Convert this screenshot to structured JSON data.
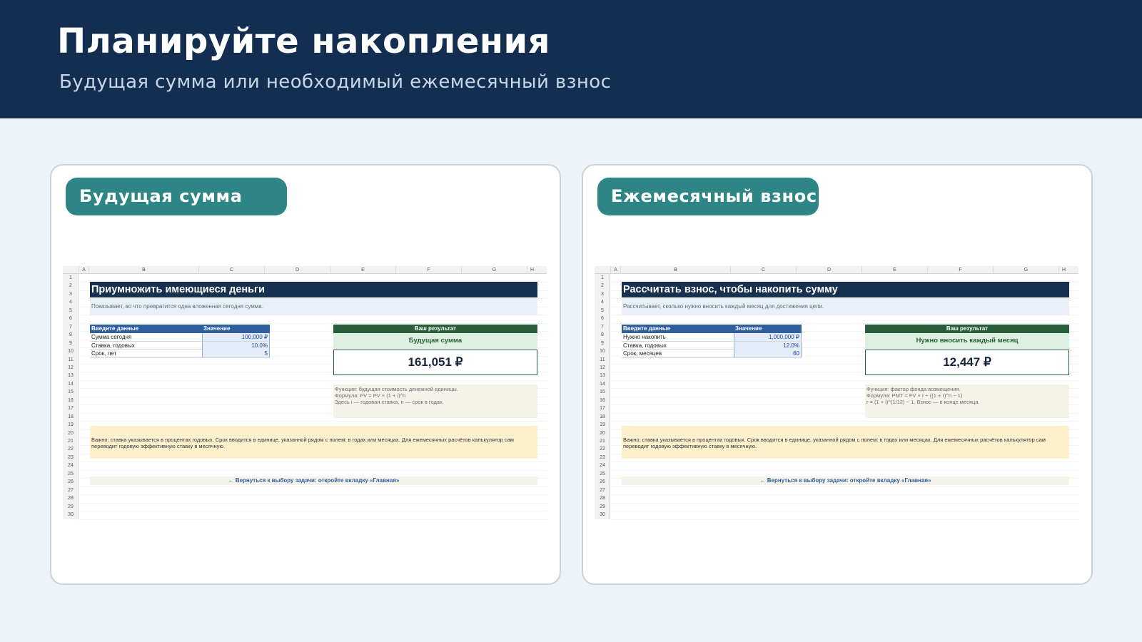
{
  "header": {
    "title": "Планируйте накопления",
    "subtitle": "Будущая сумма или необходимый ежемесячный взнос"
  },
  "columns": [
    "A",
    "B",
    "C",
    "D",
    "E",
    "F",
    "G",
    "H"
  ],
  "rows": [
    "1",
    "2",
    "3",
    "4",
    "5",
    "6",
    "7",
    "8",
    "9",
    "10",
    "11",
    "12",
    "13",
    "14",
    "15",
    "16",
    "17",
    "18",
    "19",
    "20",
    "21",
    "22",
    "23",
    "24",
    "25",
    "26",
    "27",
    "28",
    "29",
    "30"
  ],
  "left_card": {
    "pill_label": "Будущая сумма",
    "sheet": {
      "title": "Приумножить имеющиеся деньги",
      "description": "Показывает, во что превратится одна вложенная сегодня сумма.",
      "input_header": {
        "label": "Введите данные",
        "value": "Значение"
      },
      "inputs": [
        {
          "label": "Сумма сегодня",
          "value": "100,000 ₽"
        },
        {
          "label": "Ставка, годовых",
          "value": "10.0%"
        },
        {
          "label": "Срок, лет",
          "value": "5"
        }
      ],
      "result_header": "Ваш результат",
      "result_label": "Будущая сумма",
      "result_value": "161,051 ₽",
      "formula_lines": [
        "Функция: будущая стоимость денежной единицы.",
        "Формула: FV = PV × (1 + i)^n",
        "Здесь i — годовая ставка, n — срок в годах."
      ],
      "note": "Важно: ставка указывается в процентах годовых. Срок вводится в единице, указанной рядом с полем: в годах или месяцах. Для ежемесячных расчётов калькулятор сам переводит годовую эффективную ставку в месячную.",
      "back_link": "← Вернуться к выбору задачи: откройте вкладку «Главная»"
    }
  },
  "right_card": {
    "pill_label": "Ежемесячный взнос",
    "sheet": {
      "title": "Рассчитать взнос, чтобы накопить сумму",
      "description": "Рассчитывает, сколько нужно вносить каждый месяц для достижения цели.",
      "input_header": {
        "label": "Введите данные",
        "value": "Значение"
      },
      "inputs": [
        {
          "label": "Нужно накопить",
          "value": "1,000,000 ₽"
        },
        {
          "label": "Ставка, годовых",
          "value": "12.0%"
        },
        {
          "label": "Срок, месяцев",
          "value": "60"
        }
      ],
      "result_header": "Ваш результат",
      "result_label": "Нужно вносить каждый месяц",
      "result_value": "12,447 ₽",
      "formula_lines": [
        "Функция: фактор фонда возмещения.",
        "Формула: PMT = FV × r ÷ ((1 + r)^n − 1)",
        "r = (1 + i)^(1/12) − 1. Взнос — в конце месяца."
      ],
      "note": "Важно: ставка указывается в процентах годовых. Срок вводится в единице, указанной рядом с полем: в годах или месяцах. Для ежемесячных расчётов калькулятор сам переводит годовую эффективную ставку в месячную.",
      "back_link": "← Вернуться к выбору задачи: откройте вкладку «Главная»"
    }
  }
}
